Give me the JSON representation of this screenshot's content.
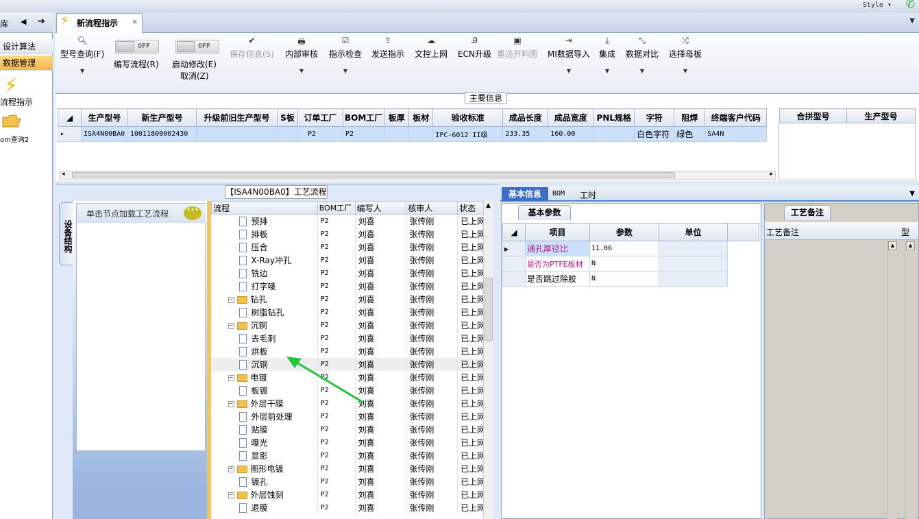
{
  "window": {
    "style_label": "Style ▾",
    "phone_icon": "phone-icon"
  },
  "leftnav": {
    "partial_label": "库",
    "items": [
      {
        "label": "设计算法"
      },
      {
        "label": "数据管理"
      },
      {
        "label": "流程指示",
        "icon": "lightning-icon"
      },
      {
        "label": "om查询2",
        "icon": "folder-icon"
      }
    ]
  },
  "tab": {
    "label": "新流程指示",
    "close": "×"
  },
  "toolbar": {
    "buttons": [
      {
        "label": "型号查询(F)",
        "icon": "search-icon"
      },
      {
        "label": "保存信息(S)",
        "icon": "check-icon"
      },
      {
        "label": "内部审核",
        "icon": "printer-icon"
      },
      {
        "label": "指示检查",
        "icon": "checkbox-icon"
      },
      {
        "label": "发送指示",
        "icon": "upload-icon"
      },
      {
        "label": "文控上网",
        "icon": "cloud-upload-icon"
      },
      {
        "label": "ECN升级",
        "icon": "ecn-icon"
      },
      {
        "label": "重选开料图",
        "icon": "image-icon"
      },
      {
        "label": "MI数据导入",
        "icon": "import-icon"
      },
      {
        "label": "集成",
        "icon": "download-icon"
      },
      {
        "label": "数据对比",
        "icon": "compare-icon"
      },
      {
        "label": "选择母板",
        "icon": "shuffle-icon"
      }
    ],
    "toggles": [
      {
        "state": "OFF",
        "label": "编写流程(R)"
      },
      {
        "state": "OFF",
        "label": "启动修改(E)",
        "sublabel": "取消(Z)"
      }
    ]
  },
  "main_info": {
    "title": "主要信息",
    "columns": [
      "生产型号",
      "新生产型号",
      "升级前旧生产型号",
      "S板",
      "订单工厂",
      "BOM工厂",
      "板厚",
      "板材",
      "验收标准",
      "成品长度",
      "成品宽度",
      "PNL规格",
      "字符",
      "阻焊",
      "终端客户代码"
    ],
    "row": [
      "ISA4N00BA0",
      "10011800002430",
      "",
      "",
      "P2",
      "P2",
      "",
      "",
      "IPC-6012 II级",
      "233.35",
      "160.00",
      "",
      "白色字符",
      "绿色",
      "SA4N"
    ],
    "merge_columns": [
      "合拼型号",
      "生产型号"
    ]
  },
  "process": {
    "title": "【ISA4N00BA0】工艺流程",
    "equipment_tab": "设备结构",
    "hint": "单击节点加载工艺流程",
    "columns": [
      "流程",
      "BOM工厂",
      "编写人",
      "核审人",
      "状态"
    ],
    "rows": [
      {
        "name": "预排",
        "type": "doc",
        "factory": "P2",
        "writer": "刘喜",
        "reviewer": "张传刚",
        "status": "已上网"
      },
      {
        "name": "排板",
        "type": "doc",
        "factory": "P2",
        "writer": "刘喜",
        "reviewer": "张传刚",
        "status": "已上网"
      },
      {
        "name": "压合",
        "type": "doc",
        "factory": "P2",
        "writer": "刘喜",
        "reviewer": "张传刚",
        "status": "已上网"
      },
      {
        "name": "X-Ray冲孔",
        "type": "doc",
        "factory": "P2",
        "writer": "刘喜",
        "reviewer": "张传刚",
        "status": "已上网"
      },
      {
        "name": "铣边",
        "type": "doc",
        "factory": "P2",
        "writer": "刘喜",
        "reviewer": "张传刚",
        "status": "已上网"
      },
      {
        "name": "打字唛",
        "type": "doc",
        "factory": "P2",
        "writer": "刘喜",
        "reviewer": "张传刚",
        "status": "已上网"
      },
      {
        "name": "钻孔",
        "type": "folder",
        "factory": "P2",
        "writer": "刘喜",
        "reviewer": "张传刚",
        "status": "已上网"
      },
      {
        "name": "树脂钻孔",
        "type": "doc",
        "factory": "P2",
        "writer": "刘喜",
        "reviewer": "张传刚",
        "status": "已上网"
      },
      {
        "name": "沉铜",
        "type": "folder",
        "factory": "P2",
        "writer": "刘喜",
        "reviewer": "张传刚",
        "status": "已上网"
      },
      {
        "name": "去毛刺",
        "type": "doc",
        "factory": "P2",
        "writer": "刘喜",
        "reviewer": "张传刚",
        "status": "已上网"
      },
      {
        "name": "烘板",
        "type": "doc",
        "factory": "P2",
        "writer": "刘喜",
        "reviewer": "张传刚",
        "status": "已上网"
      },
      {
        "name": "沉铜",
        "type": "doc",
        "factory": "P2",
        "writer": "刘喜",
        "reviewer": "张传刚",
        "status": "已上网"
      },
      {
        "name": "电镀",
        "type": "folder",
        "factory": "P2",
        "writer": "刘喜",
        "reviewer": "张传刚",
        "status": "已上网"
      },
      {
        "name": "板镀",
        "type": "doc",
        "factory": "P2",
        "writer": "刘喜",
        "reviewer": "张传刚",
        "status": "已上网"
      },
      {
        "name": "外层干膜",
        "type": "folder",
        "factory": "P2",
        "writer": "刘喜",
        "reviewer": "张传刚",
        "status": "已上网"
      },
      {
        "name": "外层前处理",
        "type": "doc",
        "factory": "P2",
        "writer": "刘喜",
        "reviewer": "张传刚",
        "status": "已上网"
      },
      {
        "name": "贴膜",
        "type": "doc",
        "factory": "P2",
        "writer": "刘喜",
        "reviewer": "张传刚",
        "status": "已上网"
      },
      {
        "name": "曝光",
        "type": "doc",
        "factory": "P2",
        "writer": "刘喜",
        "reviewer": "张传刚",
        "status": "已上网"
      },
      {
        "name": "显影",
        "type": "doc",
        "factory": "P2",
        "writer": "刘喜",
        "reviewer": "张传刚",
        "status": "已上网"
      },
      {
        "name": "图形电镀",
        "type": "folder",
        "factory": "P2",
        "writer": "刘喜",
        "reviewer": "张传刚",
        "status": "已上网"
      },
      {
        "name": "镀孔",
        "type": "doc",
        "factory": "P2",
        "writer": "刘喜",
        "reviewer": "张传刚",
        "status": "已上网"
      },
      {
        "name": "外层蚀刻",
        "type": "folder",
        "factory": "P2",
        "writer": "刘喜",
        "reviewer": "张传刚",
        "status": "已上网"
      },
      {
        "name": "退膜",
        "type": "doc",
        "factory": "P2",
        "writer": "刘喜",
        "reviewer": "张传刚",
        "status": "已上网"
      }
    ]
  },
  "right_panel": {
    "tabs": [
      "基本信息",
      "BOM",
      "工时"
    ],
    "params_title": "基本参数",
    "param_columns": [
      "项目",
      "参数",
      "单位"
    ],
    "params": [
      {
        "item": "通孔厚径比",
        "value": "11.06",
        "unit": ""
      },
      {
        "item": "是否为PTFE板材",
        "value": "N",
        "unit": ""
      },
      {
        "item": "是否跳过除胶",
        "value": "N",
        "unit": ""
      }
    ],
    "notes_title": "工艺备注",
    "notes_column": "工艺备注",
    "notes_type_column": "型"
  },
  "colors": {
    "accent": "#3b70c4",
    "selected_nav": "#f6b649",
    "highlight_text": "#c0108c",
    "annotation_arrow": "#22c43a"
  }
}
